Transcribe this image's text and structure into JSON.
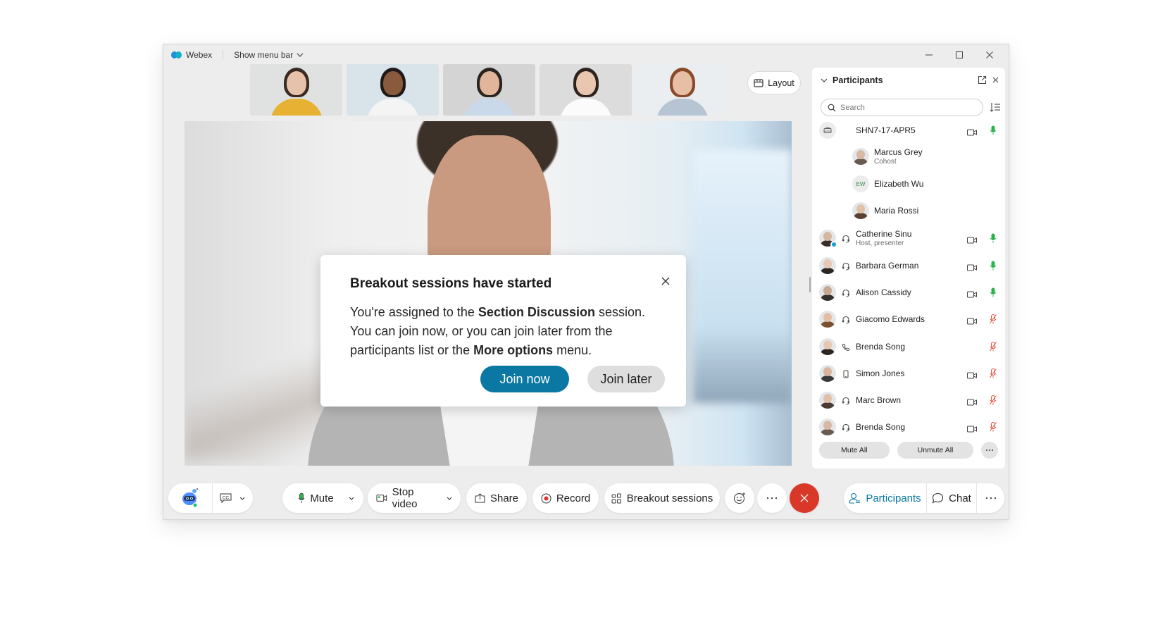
{
  "titlebar": {
    "app_name": "Webex",
    "menu_toggle": "Show menu bar",
    "controls": [
      "minimize",
      "maximize",
      "close"
    ]
  },
  "thumbnails": [
    {
      "bg": "#dfe2e0",
      "hair": "#3a2a22",
      "skin": "#e7c2ab",
      "shirt": "#e7b234"
    },
    {
      "bg": "#d8e3ea",
      "hair": "#1e1a18",
      "skin": "#8a5a3e",
      "shirt": "#f4f4f4"
    },
    {
      "bg": "#d4d4d4",
      "hair": "#2a2420",
      "skin": "#e0b59a",
      "shirt": "#cad9ea"
    },
    {
      "bg": "#dcdcdc",
      "hair": "#2d221e",
      "skin": "#e8c6b0",
      "shirt": "#fbfbfb"
    },
    {
      "bg": "#eaeef0",
      "hair": "#8a4a2a",
      "skin": "#e6bfa4",
      "shirt": "#b6c4d4"
    }
  ],
  "layout_button": "Layout",
  "dialog": {
    "title": "Breakout sessions have started",
    "line1_pre": "You're assigned to the ",
    "line1_bold": "Section Discussion",
    "line1_post": " session.",
    "line2": "You can join now, or you can join later from the",
    "line3_pre": "participants list or the ",
    "line3_bold": "More options",
    "line3_post": " menu.",
    "join_now": "Join now",
    "join_later": "Join later"
  },
  "participants_panel": {
    "title": "Participants",
    "search_placeholder": "Search",
    "device": {
      "name": "SHN7-17-APR5",
      "video": true,
      "mic": "on"
    },
    "device_members": [
      {
        "name": "Marcus Grey",
        "role": "Cohost"
      },
      {
        "name": "Elizabeth Wu",
        "initials": "EW",
        "role": ""
      },
      {
        "name": "Maria Rossi",
        "role": ""
      }
    ],
    "list": [
      {
        "name": "Catherine Sinu",
        "role": "Host, presenter",
        "connection": "headset",
        "video": true,
        "mic": "on"
      },
      {
        "name": "Barbara German",
        "role": "",
        "connection": "headset",
        "video": true,
        "mic": "on"
      },
      {
        "name": "Alison Cassidy",
        "role": "",
        "connection": "headset",
        "video": true,
        "mic": "on"
      },
      {
        "name": "Giacomo Edwards",
        "role": "",
        "connection": "headset",
        "video": true,
        "mic": "muted"
      },
      {
        "name": "Brenda Song",
        "role": "",
        "connection": "phone",
        "video": false,
        "mic": "muted"
      },
      {
        "name": "Simon Jones",
        "role": "",
        "connection": "mobile",
        "video": true,
        "mic": "muted"
      },
      {
        "name": "Marc Brown",
        "role": "",
        "connection": "headset",
        "video": true,
        "mic": "muted"
      },
      {
        "name": "Brenda Song",
        "role": "",
        "connection": "headset",
        "video": true,
        "mic": "muted"
      }
    ],
    "mute_all": "Mute All",
    "unmute_all": "Unmute All"
  },
  "toolbar": {
    "mute": "Mute",
    "stop_video": "Stop video",
    "share": "Share",
    "record": "Record",
    "breakout_sessions": "Breakout sessions",
    "participants": "Participants",
    "chat": "Chat"
  },
  "colors": {
    "accent": "#0a78a3",
    "end_call": "#d93829",
    "mic_on": "#2bb24c",
    "mic_muted": "#e8503a"
  }
}
